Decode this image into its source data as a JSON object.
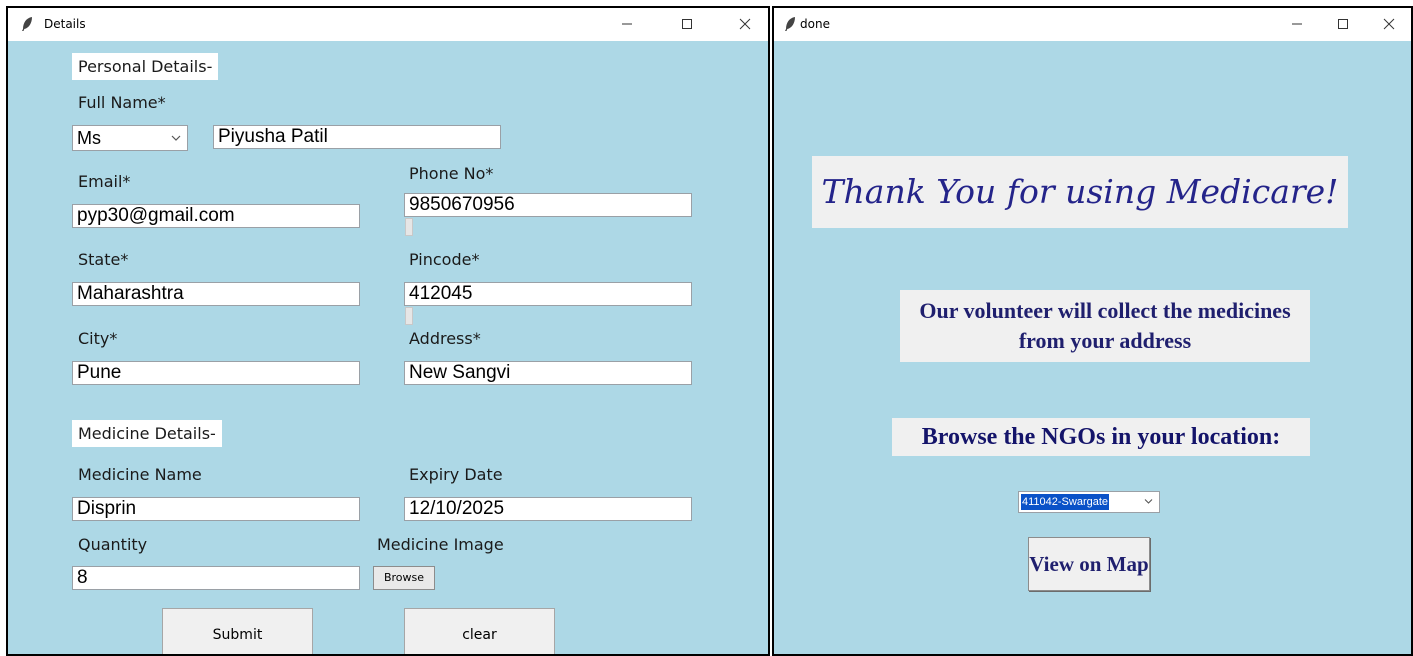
{
  "details_window": {
    "title": "Details",
    "sections": {
      "personal": "Personal Details-",
      "medicine": "Medicine Details-"
    },
    "labels": {
      "full_name": "Full Name*",
      "email": "Email*",
      "phone": "Phone No*",
      "state": "State*",
      "pincode": "Pincode*",
      "city": "City*",
      "address": "Address*",
      "medicine_name": "Medicine Name",
      "expiry_date": "Expiry Date",
      "quantity": "Quantity",
      "medicine_image": "Medicine Image"
    },
    "values": {
      "salutation": "Ms",
      "full_name": "Piyusha Patil",
      "email": "pyp30@gmail.com",
      "phone": "9850670956",
      "state": "Maharashtra",
      "pincode": "412045",
      "city": "Pune",
      "address": "New Sangvi",
      "medicine_name": "Disprin",
      "expiry_date": "12/10/2025",
      "quantity": "8"
    },
    "buttons": {
      "browse": "Browse",
      "submit": "Submit",
      "clear": "clear"
    }
  },
  "done_window": {
    "title": "done",
    "thank_you": "Thank You for using Medicare!",
    "volunteer_line1": "Our volunteer will collect the medicines",
    "volunteer_line2": "from your address",
    "browse_heading": "Browse the NGOs in your location:",
    "ngo_selected": "411042-Swargate",
    "map_button": "View on Map"
  },
  "colors": {
    "window_bg": "#add8e6",
    "titlebar_bg": "#ffffff",
    "heading_text": "#24248a",
    "selection": "#0a52c8"
  },
  "icons": {
    "app": "feather-icon",
    "minimize": "minimize-icon",
    "maximize": "maximize-icon",
    "close": "close-icon",
    "dropdown": "chevron-down-icon"
  }
}
